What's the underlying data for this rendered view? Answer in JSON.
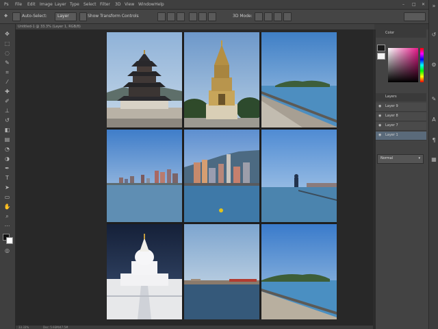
{
  "menubar": {
    "items": [
      "File",
      "Edit",
      "Image",
      "Layer",
      "Type",
      "Select",
      "Filter",
      "3D",
      "View",
      "Window",
      "Help"
    ]
  },
  "options": {
    "auto_select_label": "Auto-Select:",
    "auto_select_value": "Layer",
    "transform_controls_label": "Show Transform Controls",
    "mode_3d_label": "3D Mode:"
  },
  "document_tab": {
    "label": "Untitled-1 @ 33.3% (Layer 1, RGB/8)"
  },
  "status": {
    "zoom": "33.33%",
    "doc_info": "Doc: 5.93M/47.5M"
  },
  "panels": {
    "color_tab": "Color",
    "layers_tab": "Layers",
    "layers": [
      {
        "label": "Layer 9"
      },
      {
        "label": "Layer 8"
      },
      {
        "label": "Layer 7"
      },
      {
        "label": "Layer 1"
      }
    ],
    "blend_mode": "Normal"
  },
  "canvas": {
    "photos": [
      {
        "subject": "pagoda-temple",
        "sky": "#9db9d6"
      },
      {
        "subject": "golden-stupa",
        "sky": "#7ba2cf"
      },
      {
        "subject": "coastal-promenade",
        "sky": "#4b86c8"
      },
      {
        "subject": "city-skyline-waterfront",
        "sky": "#4f8ad0"
      },
      {
        "subject": "mountain-city-harbor",
        "sky": "#6e9bd0"
      },
      {
        "subject": "sea-statue",
        "sky": "#5e97d8"
      },
      {
        "subject": "white-stupa-night",
        "sky": "#1e2a4a"
      },
      {
        "subject": "distant-shore",
        "sky": "#8cb0d5"
      },
      {
        "subject": "island-promenade",
        "sky": "#3d7fd0"
      }
    ]
  },
  "colors": {
    "accent": "#e8198b",
    "hue_bar_top": "#ff0000"
  }
}
